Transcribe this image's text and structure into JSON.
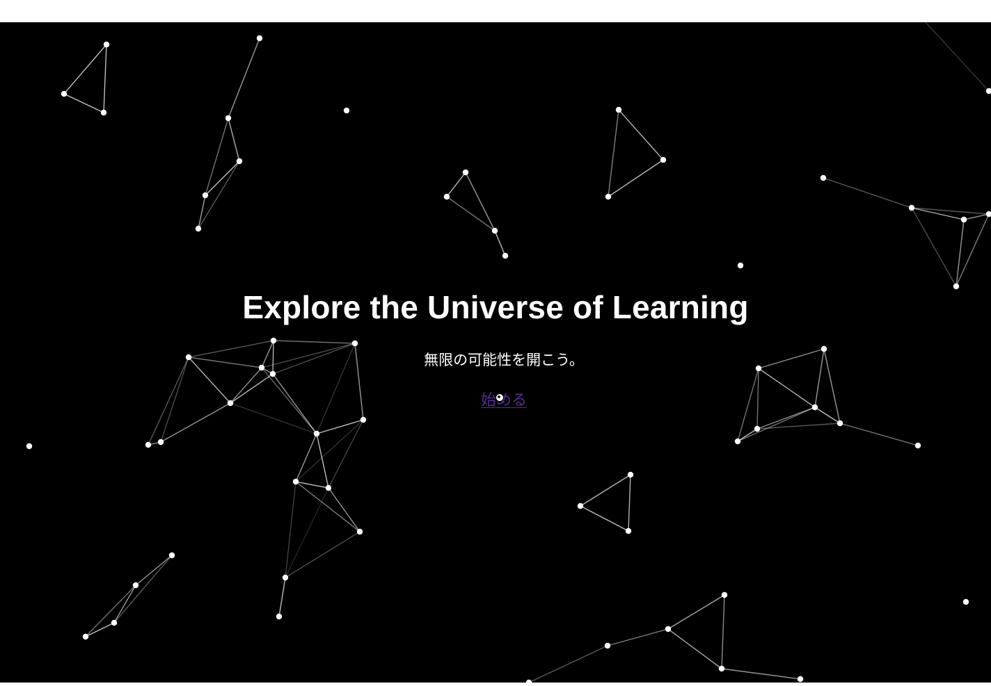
{
  "hero": {
    "title": "Explore the Universe of Learning",
    "subtitle": "無限の可能性を開こう。",
    "cta_label": "始める"
  },
  "theme": {
    "background": "#000000",
    "text": "#ffffff",
    "link": "#5a2a94",
    "node": "#ffffff",
    "edge": "#ffffff"
  },
  "icons": {
    "cursor": "mouse-cursor-icon"
  }
}
